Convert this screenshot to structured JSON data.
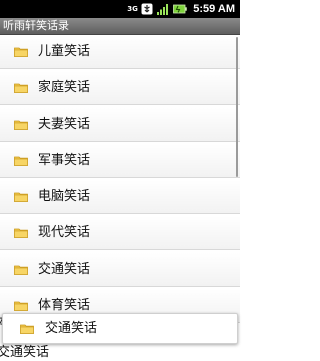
{
  "status_bar": {
    "network": "3G",
    "time": "5:59 AM",
    "icons": [
      "3g-icon",
      "usb-icon",
      "signal-icon",
      "battery-icon"
    ]
  },
  "app": {
    "title": "听雨轩笑话录"
  },
  "list": {
    "items": [
      {
        "label": "儿童笑话"
      },
      {
        "label": "家庭笑话"
      },
      {
        "label": "夫妻笑话"
      },
      {
        "label": "军事笑话"
      },
      {
        "label": "电脑笑话"
      },
      {
        "label": "现代笑话"
      },
      {
        "label": "交通笑话"
      },
      {
        "label": "体育笑话"
      }
    ]
  },
  "overlay": {
    "label": "交通笑话",
    "ghost_left": "体育",
    "ghost_bottom": "交通笑话"
  },
  "colors": {
    "folder": "#f0c648",
    "folder_edge": "#c99a1e",
    "title_bar": "#6e6e6e"
  }
}
